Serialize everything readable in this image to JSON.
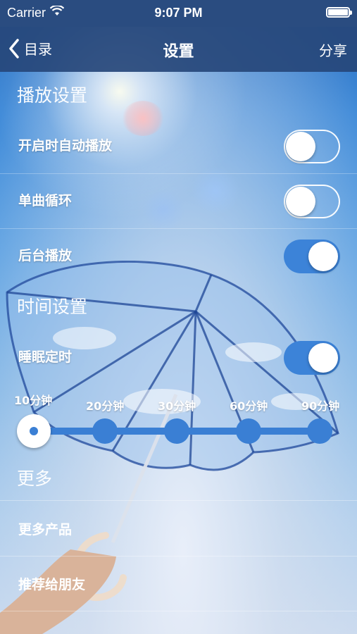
{
  "status_bar": {
    "carrier": "Carrier",
    "time": "9:07 PM"
  },
  "nav": {
    "back_label": "目录",
    "title": "设置",
    "share_label": "分享"
  },
  "playback_section": {
    "title": "播放设置",
    "items": [
      {
        "label": "开启时自动播放",
        "on": false
      },
      {
        "label": "单曲循环",
        "on": false
      },
      {
        "label": "后台播放",
        "on": true
      }
    ]
  },
  "time_section": {
    "title": "时间设置",
    "sleep_timer": {
      "label": "睡眠定时",
      "on": true
    },
    "timer_options": [
      "10分钟",
      "20分钟",
      "30分钟",
      "60分钟",
      "90分钟"
    ],
    "selected_timer": "10分钟"
  },
  "more_section": {
    "title": "更多",
    "items": [
      {
        "label": "更多产品"
      },
      {
        "label": "推荐给朋友"
      }
    ]
  },
  "colors": {
    "toggle_on": "#3c83d8",
    "nav_bar": "#26467a",
    "slider": "#3a7fd4"
  }
}
